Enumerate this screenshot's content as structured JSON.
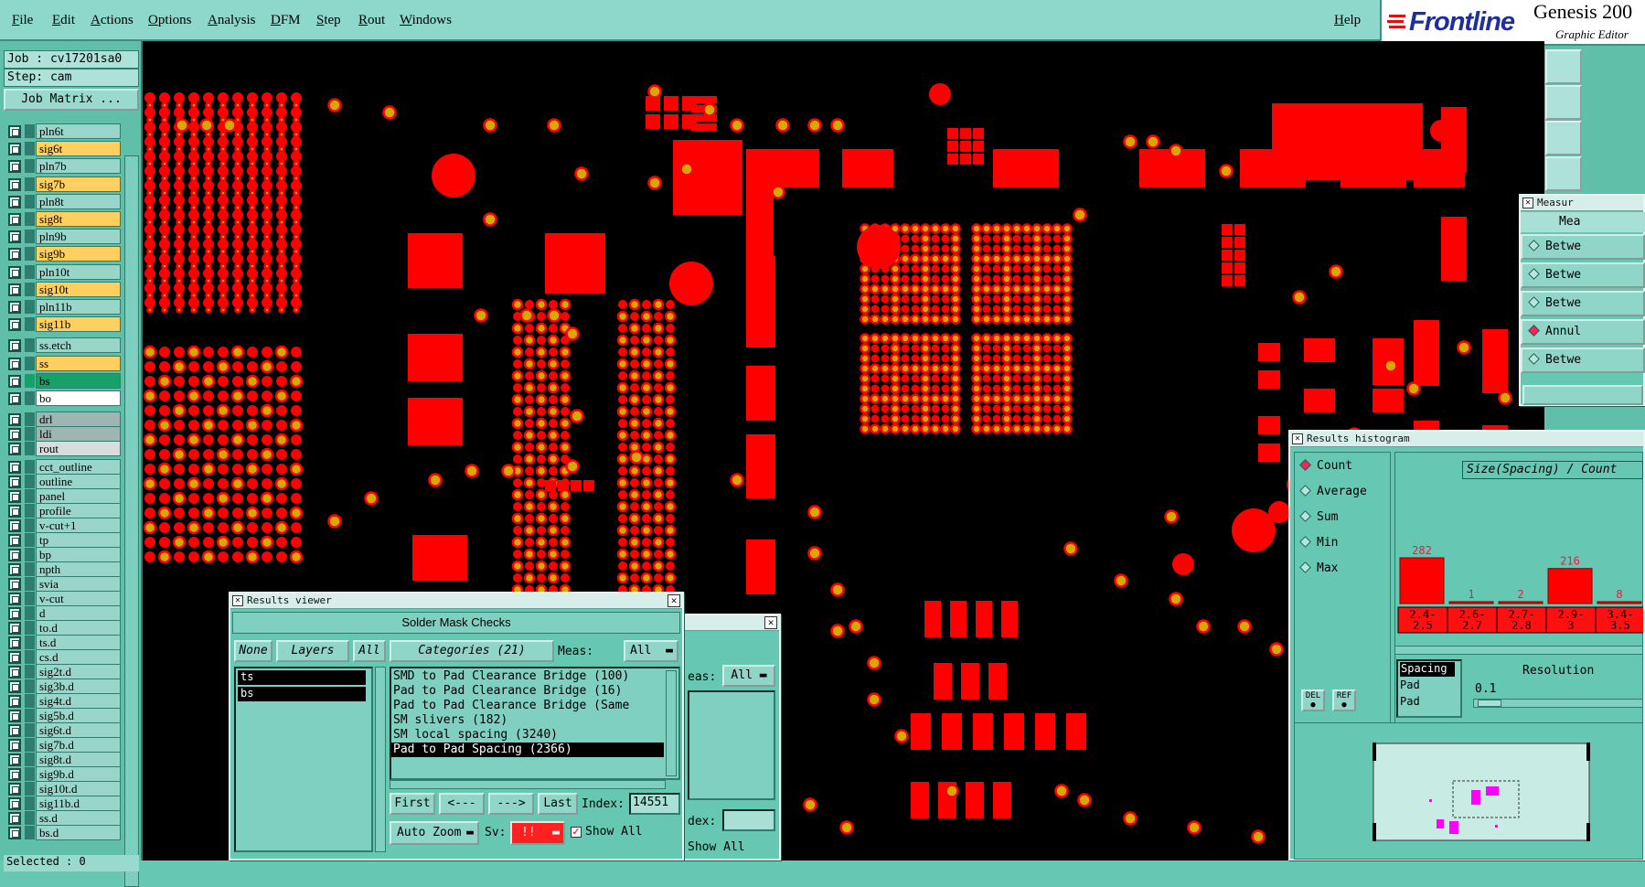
{
  "menubar": {
    "items": [
      "File",
      "Edit",
      "Actions",
      "Options",
      "Analysis",
      "DFM",
      "Step",
      "Rout",
      "Windows"
    ],
    "help": "Help"
  },
  "brand": {
    "logo_text": "Frontline",
    "product": "Genesis 200",
    "subtitle": "Graphic Editor"
  },
  "job": {
    "job_line": "Job : cv17201sa0",
    "step_line": "Step: cam",
    "matrix_button": "Job Matrix ..."
  },
  "layers": [
    {
      "name": "pln6t",
      "color": "#99d6c9"
    },
    {
      "name": "sig6t",
      "color": "#ffd060"
    },
    {
      "name": "pln7b",
      "color": "#99d6c9"
    },
    {
      "name": "sig7b",
      "color": "#ffd060"
    },
    {
      "name": "pln8t",
      "color": "#99d6c9"
    },
    {
      "name": "sig8t",
      "color": "#ffd060"
    },
    {
      "name": "pln9b",
      "color": "#99d6c9"
    },
    {
      "name": "sig9b",
      "color": "#ffd060"
    },
    {
      "name": "pln10t",
      "color": "#99d6c9"
    },
    {
      "name": "sig10t",
      "color": "#ffd060"
    },
    {
      "name": "pln11b",
      "color": "#99d6c9"
    },
    {
      "name": "sig11b",
      "color": "#ffd060"
    },
    {
      "name": "ss.etch",
      "color": "#99d6c9"
    },
    {
      "name": "ss",
      "color": "#ffd060"
    },
    {
      "name": "bs",
      "color": "#16a06a"
    },
    {
      "name": "bo",
      "color": "#ffffff"
    },
    {
      "name": "drl",
      "color": "#9fb5b2"
    },
    {
      "name": "ldi",
      "color": "#9fb5b2"
    },
    {
      "name": "rout",
      "color": "#d8dcdc"
    },
    {
      "name": "cct_outline",
      "color": "#99d6c9"
    },
    {
      "name": "outline",
      "color": "#99d6c9"
    },
    {
      "name": "panel",
      "color": "#99d6c9"
    },
    {
      "name": "profile",
      "color": "#99d6c9"
    },
    {
      "name": "v-cut+1",
      "color": "#99d6c9"
    },
    {
      "name": "tp",
      "color": "#99d6c9"
    },
    {
      "name": "bp",
      "color": "#99d6c9"
    },
    {
      "name": "npth",
      "color": "#99d6c9"
    },
    {
      "name": "svia",
      "color": "#99d6c9"
    },
    {
      "name": "v-cut",
      "color": "#99d6c9"
    },
    {
      "name": "d",
      "color": "#99d6c9"
    },
    {
      "name": "to.d",
      "color": "#99d6c9"
    },
    {
      "name": "ts.d",
      "color": "#99d6c9"
    },
    {
      "name": "cs.d",
      "color": "#99d6c9"
    },
    {
      "name": "sig2t.d",
      "color": "#99d6c9"
    },
    {
      "name": "sig3b.d",
      "color": "#99d6c9"
    },
    {
      "name": "sig4t.d",
      "color": "#99d6c9"
    },
    {
      "name": "sig5b.d",
      "color": "#99d6c9"
    },
    {
      "name": "sig6t.d",
      "color": "#99d6c9"
    },
    {
      "name": "sig7b.d",
      "color": "#99d6c9"
    },
    {
      "name": "sig8t.d",
      "color": "#99d6c9"
    },
    {
      "name": "sig9b.d",
      "color": "#99d6c9"
    },
    {
      "name": "sig10t.d",
      "color": "#99d6c9"
    },
    {
      "name": "sig11b.d",
      "color": "#99d6c9"
    },
    {
      "name": "ss.d",
      "color": "#99d6c9"
    },
    {
      "name": "bs.d",
      "color": "#99d6c9"
    }
  ],
  "selected_text": "Selected : 0",
  "colors": {
    "pad": "#ff0000",
    "via_ring": "#d6a800",
    "background": "#000000",
    "panel": "#66c8b2"
  },
  "results_viewer": {
    "title": "Results viewer",
    "header": "Solder Mask Checks",
    "none_button": "None",
    "layers_button": "Layers",
    "all_button": "All",
    "categories_button": "Categories (21)",
    "meas_label": "Meas:",
    "meas_value": "All",
    "layers_list": [
      "ts",
      "bs"
    ],
    "categories": [
      "SMD to Pad Clearance Bridge (100)",
      "Pad to Pad Clearance Bridge (16)",
      "Pad to Pad Clearance Bridge (Same",
      "SM slivers (182)",
      "SM local spacing (3240)",
      "Pad to Pad Spacing (2366)"
    ],
    "selected_category": "Pad to Pad Spacing (2366)",
    "first_button": "First",
    "prev_button": "<---",
    "next_button": "--->",
    "last_button": "Last",
    "index_label": "Index:",
    "index_value": "14551",
    "autozoom_button": "Auto Zoom",
    "sv_label": "Sv:",
    "sv_value": "!!",
    "show_all_label": "Show All"
  },
  "back_window": {
    "meas_label": "eas:",
    "meas_value": "All",
    "index_label": "dex:",
    "show_all_label": "Show All"
  },
  "measure_window": {
    "title": "Measur",
    "header": "Mea",
    "options": [
      "Betwe",
      "Betwe",
      "Betwe",
      "Annul",
      "Betwe"
    ],
    "selected_index": 3
  },
  "histogram": {
    "title": "Results histogram",
    "options": [
      "Count",
      "Average",
      "Sum",
      "Min",
      "Max"
    ],
    "selected_option": "Count",
    "axis_title": "Size(Spacing) / Count",
    "del_button": "DEL",
    "ref_button": "REF",
    "list_items": [
      "Spacing",
      "Pad",
      "Pad"
    ],
    "resolution_label": "Resolution",
    "resolution_value": "0.1"
  },
  "chart_data": {
    "type": "bar",
    "categories": [
      "2.4-2.5",
      "2.6-2.7",
      "2.7-2.8",
      "2.9-3",
      "3.4-3.5"
    ],
    "values": [
      282,
      1,
      2,
      216,
      8
    ],
    "value_labels": [
      "282",
      "1",
      "2",
      "216",
      "8"
    ],
    "bin_label_top": [
      "2.4-",
      "2.6-",
      "2.7-",
      "2.9-",
      "3.4-"
    ],
    "bin_label_bottom": [
      "2.5",
      "2.7",
      "2.8",
      "3",
      "3.5"
    ]
  }
}
